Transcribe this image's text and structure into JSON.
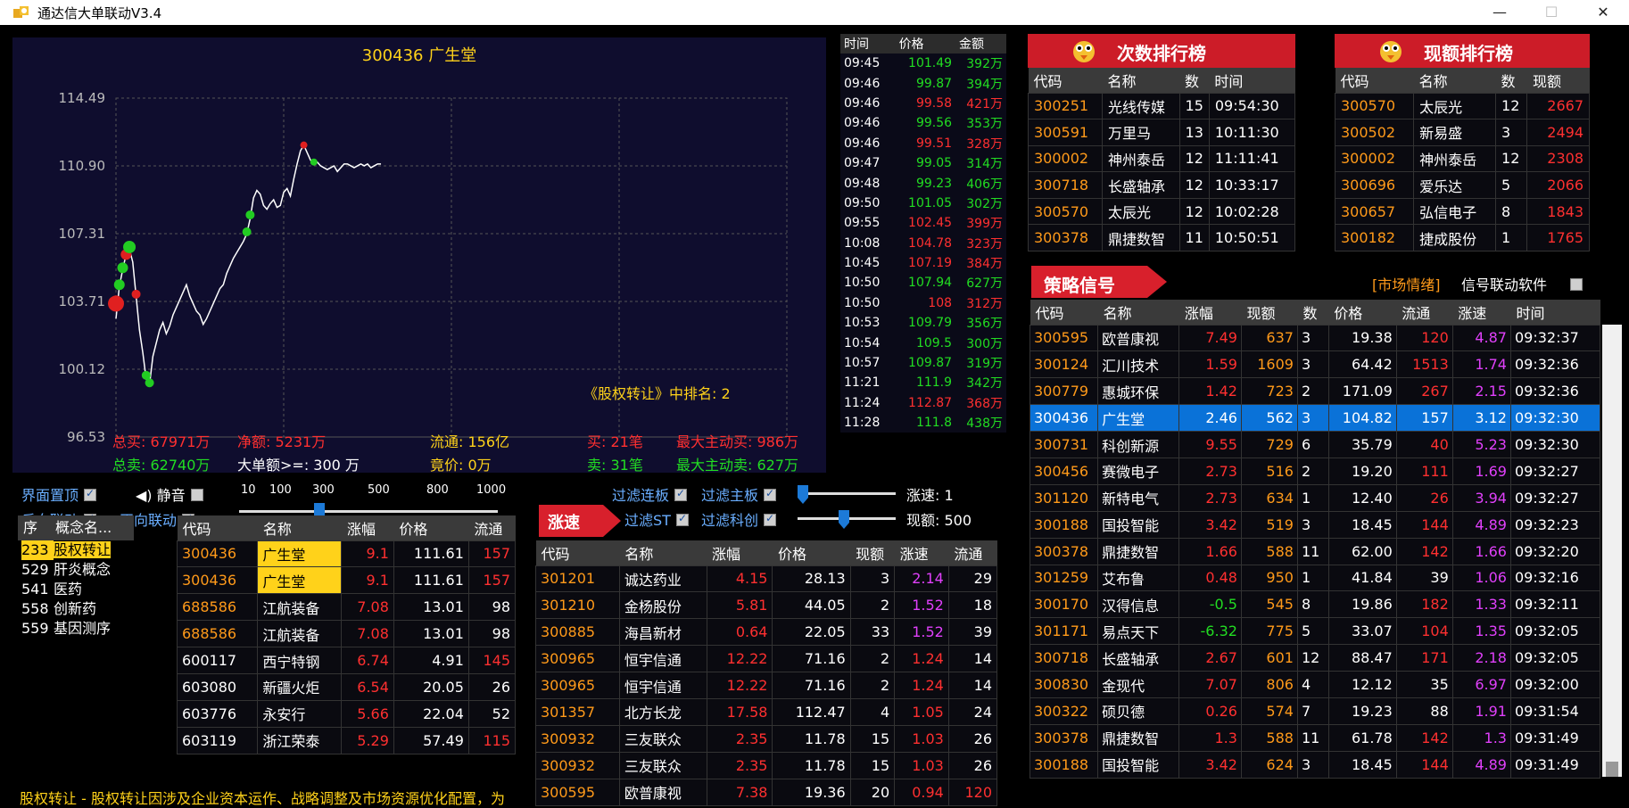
{
  "window": {
    "title": "通达信大单联动V3.4"
  },
  "chart": {
    "title": "300436 广生堂",
    "rank_text": "《股权转让》中排名: 2",
    "stats": {
      "total_buy": "总买: 67971万",
      "net": "净额: 5231万",
      "float": "流通: 156亿",
      "buy_count": "买: 21笔",
      "max_buy": "最大主动买: 986万",
      "total_sell": "总卖: 62740万",
      "threshold": "大单额>=: 300 万",
      "bid": "竟价: 0万",
      "sell_count": "卖: 31笔",
      "max_sell": "最大主动卖: 627万"
    }
  },
  "chart_data": {
    "type": "line",
    "title": "300436 广生堂",
    "y_ticks": [
      "114.49",
      "110.90",
      "107.31",
      "103.71",
      "100.12",
      "96.53"
    ],
    "ylim": [
      96.53,
      114.49
    ],
    "x": [
      0,
      4,
      8,
      12,
      16,
      20,
      24,
      28,
      32,
      36,
      40,
      44,
      48,
      52,
      56,
      60,
      64,
      68,
      72,
      76,
      80,
      84,
      88,
      92,
      96,
      100,
      104,
      108,
      112,
      116,
      120,
      124,
      128,
      132,
      136,
      140,
      144,
      148,
      152,
      156,
      160,
      164,
      168,
      172,
      176,
      180,
      184,
      188,
      192,
      196,
      200,
      204,
      208,
      212,
      216,
      220,
      224,
      228,
      232,
      236,
      240,
      244,
      248,
      252,
      256,
      260,
      264,
      268,
      272,
      276,
      280,
      284,
      288,
      292,
      296,
      300,
      304,
      308,
      312,
      316
    ],
    "values": [
      102.8,
      104.5,
      105.4,
      106.2,
      106.5,
      105.8,
      104.0,
      102.2,
      101.0,
      99.6,
      99.3,
      100.8,
      101.5,
      102.2,
      102.6,
      102.0,
      102.4,
      103.0,
      103.4,
      103.8,
      104.2,
      104.6,
      104.0,
      103.6,
      103.2,
      103.0,
      102.5,
      102.8,
      103.2,
      103.6,
      104.0,
      104.4,
      104.6,
      105.2,
      105.6,
      106.0,
      106.3,
      106.6,
      106.9,
      107.3,
      108.1,
      109.2,
      109.6,
      109.4,
      108.8,
      108.6,
      108.9,
      109.1,
      108.7,
      108.8,
      109.5,
      109.7,
      109.3,
      110.2,
      111.0,
      111.7,
      112.0,
      111.6,
      111.2,
      111.0,
      111.1,
      110.9,
      110.8,
      110.7,
      110.8,
      110.9,
      110.6,
      110.8,
      111.0,
      111.0,
      110.9,
      110.8,
      110.9,
      111.0,
      110.9,
      111.0,
      110.8,
      110.9,
      111.0,
      111.0
    ],
    "grid": true
  },
  "ticks": {
    "headers": [
      "时间",
      "价格",
      "金额"
    ],
    "rows": [
      [
        "09:45",
        "101.49",
        "392万",
        "g"
      ],
      [
        "09:46",
        "99.87",
        "394万",
        "g"
      ],
      [
        "09:46",
        "99.58",
        "421万",
        "r"
      ],
      [
        "09:46",
        "99.56",
        "353万",
        "g"
      ],
      [
        "09:46",
        "99.51",
        "328万",
        "r"
      ],
      [
        "09:47",
        "99.05",
        "314万",
        "g"
      ],
      [
        "09:48",
        "99.23",
        "406万",
        "g"
      ],
      [
        "09:50",
        "101.05",
        "302万",
        "g"
      ],
      [
        "09:55",
        "102.45",
        "399万",
        "r"
      ],
      [
        "10:08",
        "104.78",
        "323万",
        "r"
      ],
      [
        "10:45",
        "107.19",
        "384万",
        "r"
      ],
      [
        "10:50",
        "107.94",
        "627万",
        "g"
      ],
      [
        "10:50",
        "108",
        "312万",
        "r"
      ],
      [
        "10:53",
        "109.79",
        "356万",
        "g"
      ],
      [
        "10:54",
        "109.5",
        "300万",
        "g"
      ],
      [
        "10:57",
        "109.87",
        "319万",
        "g"
      ],
      [
        "11:21",
        "111.9",
        "342万",
        "g"
      ],
      [
        "11:24",
        "112.87",
        "368万",
        "r"
      ],
      [
        "11:28",
        "111.8",
        "438万",
        "g"
      ]
    ]
  },
  "count_rank": {
    "title": "次数排行榜",
    "headers": [
      "代码",
      "名称",
      "数",
      "时间"
    ],
    "rows": [
      [
        "300251",
        "光线传媒",
        "15",
        "09:54:30"
      ],
      [
        "300591",
        "万里马",
        "13",
        "10:11:30"
      ],
      [
        "300002",
        "神州泰岳",
        "12",
        "11:11:41"
      ],
      [
        "300718",
        "长盛轴承",
        "12",
        "10:33:17"
      ],
      [
        "300570",
        "太辰光",
        "12",
        "10:02:28"
      ],
      [
        "300378",
        "鼎捷数智",
        "11",
        "10:50:51"
      ]
    ]
  },
  "amount_rank": {
    "title": "现额排行榜",
    "headers": [
      "代码",
      "名称",
      "数",
      "现额"
    ],
    "rows": [
      [
        "300570",
        "太辰光",
        "12",
        "2667"
      ],
      [
        "300502",
        "新易盛",
        "3",
        "2494"
      ],
      [
        "300002",
        "神州泰岳",
        "12",
        "2308"
      ],
      [
        "300696",
        "爱乐达",
        "5",
        "2066"
      ],
      [
        "300657",
        "弘信电子",
        "8",
        "1843"
      ],
      [
        "300182",
        "捷成股份",
        "1",
        "1765"
      ]
    ]
  },
  "strategy": {
    "title": "策略信号",
    "market_link": "[市场情绪]",
    "signal_label": "信号联动软件",
    "headers": [
      "代码",
      "名称",
      "涨幅",
      "现额",
      "数",
      "价格",
      "流通",
      "涨速",
      "时间"
    ],
    "rows": [
      [
        "300595",
        "欧普康视",
        "7.49",
        "637",
        "3",
        "19.38",
        "120",
        "4.87",
        "09:32:37",
        "r"
      ],
      [
        "300124",
        "汇川技术",
        "1.59",
        "1609",
        "3",
        "64.42",
        "1513",
        "1.74",
        "09:32:36",
        "r"
      ],
      [
        "300779",
        "惠城环保",
        "1.42",
        "723",
        "2",
        "171.09",
        "267",
        "2.15",
        "09:32:36",
        "r"
      ],
      [
        "300436",
        "广生堂",
        "2.46",
        "562",
        "3",
        "104.82",
        "157",
        "3.12",
        "09:32:30",
        "sel"
      ],
      [
        "300731",
        "科创新源",
        "9.55",
        "729",
        "6",
        "35.79",
        "40",
        "5.23",
        "09:32:30",
        "r"
      ],
      [
        "300456",
        "赛微电子",
        "2.73",
        "516",
        "2",
        "19.20",
        "111",
        "1.69",
        "09:32:27",
        "r"
      ],
      [
        "301120",
        "新特电气",
        "2.73",
        "634",
        "1",
        "12.40",
        "26",
        "3.94",
        "09:32:27",
        "r"
      ],
      [
        "300188",
        "国投智能",
        "3.42",
        "519",
        "3",
        "18.45",
        "144",
        "4.89",
        "09:32:23",
        "r"
      ],
      [
        "300378",
        "鼎捷数智",
        "1.66",
        "588",
        "11",
        "62.00",
        "142",
        "1.66",
        "09:32:20",
        "r"
      ],
      [
        "301259",
        "艾布鲁",
        "0.48",
        "950",
        "1",
        "41.84",
        "39",
        "1.06",
        "09:32:16",
        "r"
      ],
      [
        "300170",
        "汉得信息",
        "-0.5",
        "545",
        "8",
        "19.86",
        "182",
        "1.33",
        "09:32:11",
        "g"
      ],
      [
        "301171",
        "易点天下",
        "-6.32",
        "775",
        "5",
        "33.07",
        "104",
        "1.35",
        "09:32:05",
        "g"
      ],
      [
        "300718",
        "长盛轴承",
        "2.67",
        "601",
        "12",
        "88.47",
        "171",
        "2.18",
        "09:32:05",
        "r"
      ],
      [
        "300830",
        "金现代",
        "7.07",
        "806",
        "4",
        "12.12",
        "35",
        "6.97",
        "09:32:00",
        "r"
      ],
      [
        "300322",
        "硕贝德",
        "0.26",
        "574",
        "7",
        "19.23",
        "88",
        "1.91",
        "09:31:54",
        "r"
      ],
      [
        "300378",
        "鼎捷数智",
        "1.3",
        "588",
        "11",
        "61.78",
        "142",
        "1.3",
        "09:31:49",
        "r"
      ],
      [
        "300188",
        "国投智能",
        "3.42",
        "624",
        "3",
        "18.45",
        "144",
        "4.89",
        "09:31:49",
        "r"
      ]
    ]
  },
  "controls": {
    "top_most": "界面置顶",
    "mute": "静音",
    "reverse_link": "反向联动",
    "forward_link": "正向联动",
    "scale": [
      "10",
      "100",
      "300",
      "500",
      "800",
      "1000"
    ],
    "filter_limit": "过滤连板",
    "filter_main": "过滤主板",
    "filter_st": "过滤ST",
    "filter_star": "过滤科创",
    "speed_label": "涨速: 1",
    "amount_label": "现额: 500"
  },
  "concepts": {
    "headers": [
      "序",
      "概念名..."
    ],
    "rows": [
      [
        "233",
        "股权转让"
      ],
      [
        "529",
        "肝炎概念"
      ],
      [
        "541",
        "医药"
      ],
      [
        "558",
        "创新药"
      ],
      [
        "559",
        "基因测序"
      ]
    ]
  },
  "concept_stocks": {
    "headers": [
      "代码",
      "名称",
      "涨幅",
      "价格",
      "流通"
    ],
    "rows": [
      [
        "300436",
        "广生堂",
        "9.1",
        "111.61",
        "157",
        "hl"
      ],
      [
        "300436",
        "广生堂",
        "9.1",
        "111.61",
        "157",
        "hl"
      ],
      [
        "688586",
        "江航装备",
        "7.08",
        "13.01",
        "98",
        ""
      ],
      [
        "688586",
        "江航装备",
        "7.08",
        "13.01",
        "98",
        ""
      ],
      [
        "600117",
        "西宁特钢",
        "6.74",
        "4.91",
        "145",
        ""
      ],
      [
        "603080",
        "新疆火炬",
        "6.54",
        "20.05",
        "26",
        ""
      ],
      [
        "603776",
        "永安行",
        "5.66",
        "22.04",
        "52",
        ""
      ],
      [
        "603119",
        "浙江荣泰",
        "5.29",
        "57.49",
        "115",
        ""
      ]
    ]
  },
  "speed_list": {
    "title": "涨速",
    "headers": [
      "代码",
      "名称",
      "涨幅",
      "价格",
      "现额",
      "涨速",
      "流通"
    ],
    "rows": [
      [
        "301201",
        "诚达药业",
        "4.15",
        "28.13",
        "3",
        "2.14",
        "29"
      ],
      [
        "301210",
        "金杨股份",
        "5.81",
        "44.05",
        "2",
        "1.52",
        "18"
      ],
      [
        "300885",
        "海昌新材",
        "0.64",
        "22.05",
        "33",
        "1.52",
        "39"
      ],
      [
        "300965",
        "恒宇信通",
        "12.22",
        "71.16",
        "2",
        "1.24",
        "14"
      ],
      [
        "300965",
        "恒宇信通",
        "12.22",
        "71.16",
        "2",
        "1.24",
        "14"
      ],
      [
        "301357",
        "北方长龙",
        "17.58",
        "112.47",
        "4",
        "1.05",
        "24"
      ],
      [
        "300932",
        "三友联众",
        "2.35",
        "11.78",
        "15",
        "1.03",
        "26"
      ],
      [
        "300932",
        "三友联众",
        "2.35",
        "11.78",
        "15",
        "1.03",
        "26"
      ],
      [
        "300595",
        "欧普康视",
        "7.38",
        "19.36",
        "20",
        "0.94",
        "120"
      ]
    ]
  },
  "description": "股权转让 - 股权转让因涉及企业资本运作、战略调整及市场资源优化配置，为"
}
